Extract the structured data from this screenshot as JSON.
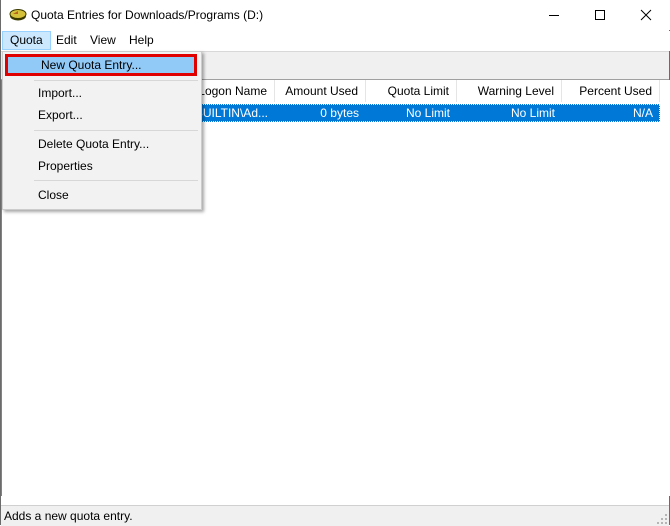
{
  "window": {
    "title": "Quota Entries for Downloads/Programs (D:)",
    "app_icon": "disk-quota-icon",
    "controls": {
      "minimize": "minimize-icon",
      "maximize": "maximize-icon",
      "close": "close-icon"
    }
  },
  "menubar": {
    "items": [
      {
        "label": "Quota",
        "active": true
      },
      {
        "label": "Edit"
      },
      {
        "label": "View"
      },
      {
        "label": "Help"
      }
    ]
  },
  "quota_menu": {
    "items": [
      {
        "label": "New Quota Entry...",
        "highlighted": true
      },
      {
        "label": "Import..."
      },
      {
        "label": "Export..."
      },
      {
        "label": "Delete Quota Entry..."
      },
      {
        "label": "Properties"
      },
      {
        "label": "Close"
      }
    ]
  },
  "list": {
    "columns": [
      "Logon Name",
      "Amount Used",
      "Quota Limit",
      "Warning Level",
      "Percent Used"
    ],
    "rows": [
      {
        "logon_name": "BUILTIN\\Ad...",
        "amount_used": "0 bytes",
        "quota_limit": "No Limit",
        "warning_level": "No Limit",
        "percent_used": "N/A",
        "selected": true
      }
    ]
  },
  "statusbar": {
    "text": "Adds a new quota entry."
  },
  "colors": {
    "selection": "#0078d7",
    "menu_highlight": "#91c9f7",
    "annotation_border": "#e00000"
  }
}
